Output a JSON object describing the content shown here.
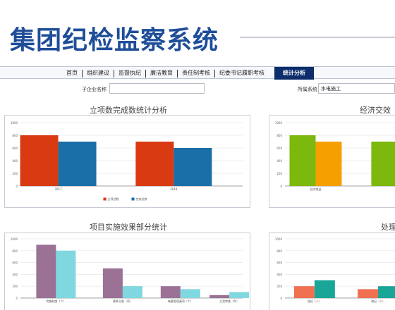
{
  "slide": {
    "title": "集团纪检监察系统"
  },
  "nav": {
    "items": [
      "首页",
      "组织建设",
      "监督执纪",
      "廉洁教育",
      "责任制考核",
      "纪委书记履职考核"
    ],
    "active": "统计分析"
  },
  "filters": {
    "company_label": "子企业名称",
    "company_value": "",
    "system_label": "所属系统",
    "system_value": "水电施工"
  },
  "panels": {
    "p1_title": "立项数完成数统计分析",
    "p2_title": "经济交效",
    "p3_title": "项目实施效果部分统计",
    "p4_title": "处理"
  },
  "chart_data": [
    {
      "type": "bar",
      "title": "立项数完成数统计分析",
      "categories": [
        "2017",
        "2018"
      ],
      "series": [
        {
          "name": "立项总数",
          "color": "#d93a12",
          "values": [
            800,
            700
          ]
        },
        {
          "name": "完成总数",
          "color": "#1b6fa8",
          "values": [
            700,
            600
          ]
        }
      ],
      "yticks": [
        0,
        200,
        400,
        600,
        800,
        1000
      ],
      "ylim": [
        0,
        1000
      ]
    },
    {
      "type": "bar",
      "title": "经济交效",
      "categories": [
        "经济效益",
        ""
      ],
      "series": [
        {
          "color": "#7cb80e",
          "values": [
            800,
            700
          ]
        },
        {
          "color": "#f5a000",
          "values": [
            700,
            null
          ]
        }
      ],
      "yticks": [
        0,
        200,
        400,
        600,
        800,
        1000
      ],
      "ylim": [
        0,
        1000
      ]
    },
    {
      "type": "bar",
      "title": "项目实施效果部分统计",
      "categories": [
        "完善制度（个）",
        "建章立制（项）",
        "堵塞管理漏洞（个）",
        "立案审查（件）"
      ],
      "series": [
        {
          "color": "#9b7295",
          "values": [
            900,
            500,
            200,
            50
          ]
        },
        {
          "color": "#7fd8e0",
          "values": [
            800,
            200,
            150,
            100
          ]
        }
      ],
      "yticks": [
        0,
        200,
        400,
        600,
        800,
        1000
      ],
      "ylim": [
        0,
        1000
      ]
    },
    {
      "type": "bar",
      "title": "处理",
      "categories": [
        "党纪（人）",
        "政纪（人）"
      ],
      "series": [
        {
          "color": "#f07052",
          "values": [
            200,
            150
          ]
        },
        {
          "color": "#1aa697",
          "values": [
            300,
            200
          ]
        }
      ],
      "yticks": [
        0,
        200,
        400,
        600,
        800,
        1000
      ],
      "ylim": [
        0,
        1000
      ]
    }
  ]
}
